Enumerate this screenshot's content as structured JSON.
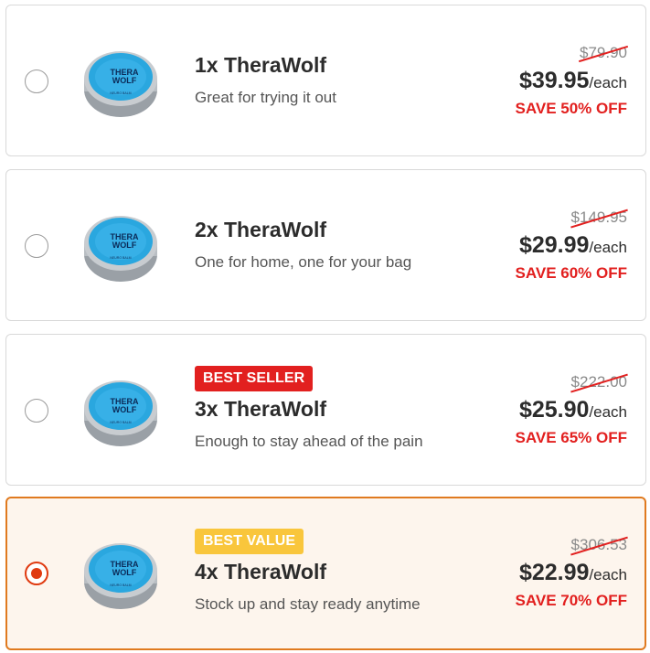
{
  "colors": {
    "accent": "#e07a1f",
    "sale": "#e2201f",
    "best_value": "#f9c63c",
    "selected_bg": "#fdf5ed"
  },
  "product_image": {
    "icon": "therawolf-tin-icon",
    "lid_text_top": "THERA",
    "lid_text_bottom": "WOLF",
    "lid_subtext": "NEURO BALM"
  },
  "options": [
    {
      "selected": false,
      "badge": "",
      "title": "1x TheraWolf",
      "description": "Great for trying it out",
      "old_price": "$79.90",
      "price": "$39.95",
      "per": "/each",
      "save": "SAVE 50% OFF"
    },
    {
      "selected": false,
      "badge": "",
      "title": "2x TheraWolf",
      "description": "One for home, one for your bag",
      "old_price": "$149.95",
      "price": "$29.99",
      "per": "/each",
      "save": "SAVE 60% OFF"
    },
    {
      "selected": false,
      "badge": "BEST SELLER",
      "title": "3x TheraWolf",
      "description": "Enough to stay ahead of the pain",
      "old_price": "$222.00",
      "price": "$25.90",
      "per": "/each",
      "save": "SAVE 65% OFF"
    },
    {
      "selected": true,
      "badge": "BEST VALUE",
      "title": "4x TheraWolf",
      "description": "Stock up and stay ready anytime",
      "old_price": "$306.53",
      "price": "$22.99",
      "per": "/each",
      "save": "SAVE 70% OFF"
    }
  ]
}
